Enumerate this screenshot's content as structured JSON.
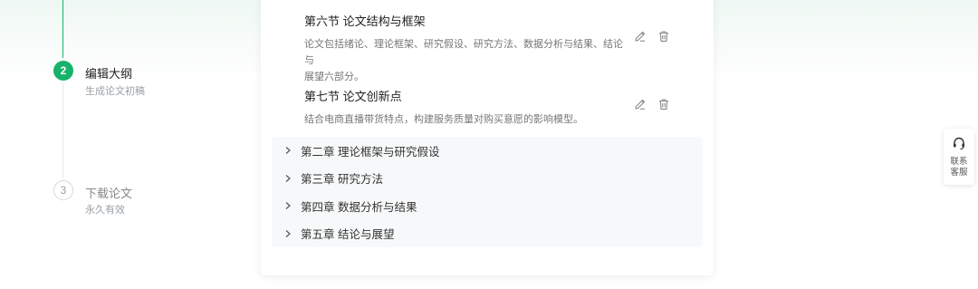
{
  "steps": [
    {
      "number": "2",
      "title": "编辑大纲",
      "subtitle": "生成论文初稿",
      "state": "active"
    },
    {
      "number": "3",
      "title": "下载论文",
      "subtitle": "永久有效",
      "state": "pending"
    }
  ],
  "sections": [
    {
      "title": "第六节 论文结构与框架",
      "desc_line1": "论文包括绪论、理论框架、研究假设、研究方法、数据分析与结果、结论与",
      "desc_line2": "展望六部分。"
    },
    {
      "title": "第七节 论文创新点",
      "desc_line1": "结合电商直播带货特点，构建服务质量对购买意愿的影响模型。"
    }
  ],
  "chapters": [
    "第二章 理论框架与研究假设",
    "第三章 研究方法",
    "第四章 数据分析与结果",
    "第五章 结论与展望"
  ],
  "service": {
    "label": "联系客服",
    "icon": "headset-icon"
  },
  "colors": {
    "accent": "#17b26a",
    "muted": "#9aa0a6",
    "panel": "#f7f8f9"
  }
}
